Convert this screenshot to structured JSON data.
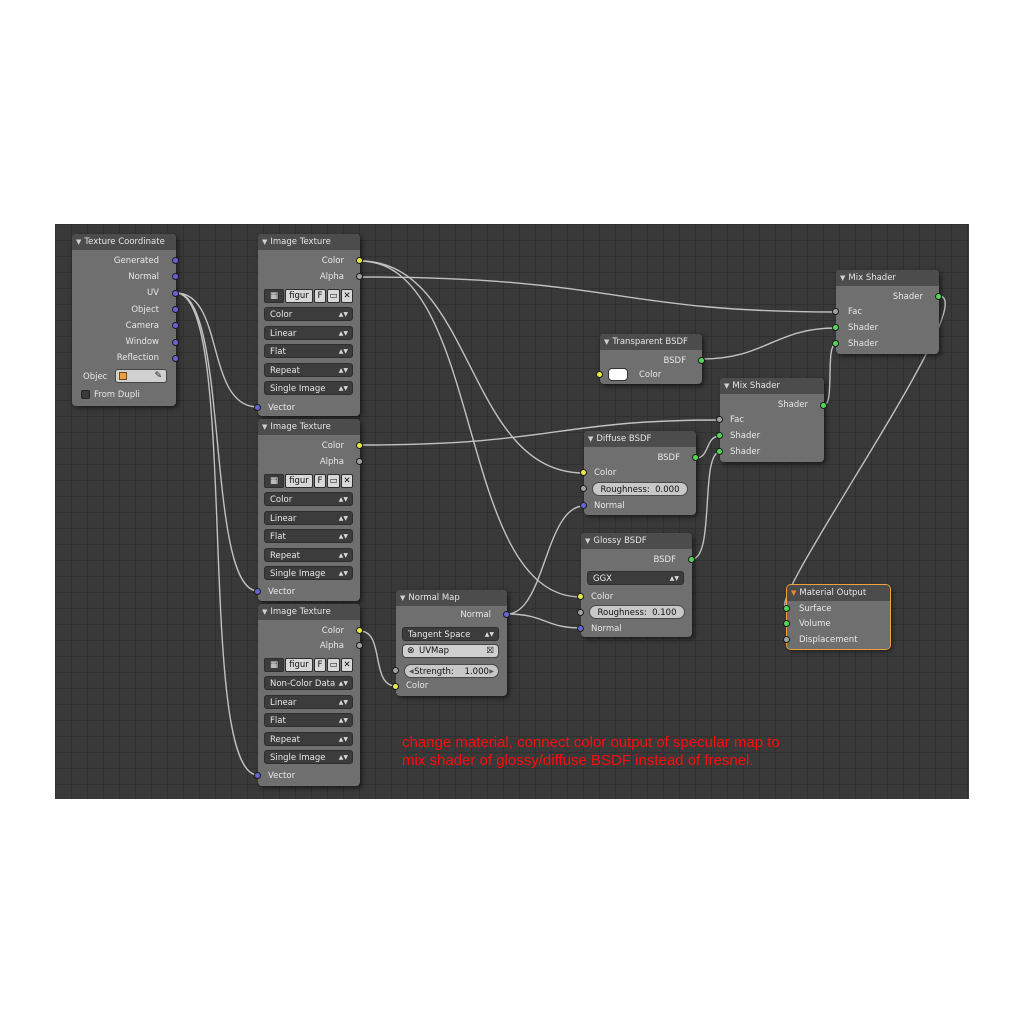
{
  "texture_coordinate": {
    "title": "Texture Coordinate",
    "outputs": [
      "Generated",
      "Normal",
      "UV",
      "Object",
      "Camera",
      "Window",
      "Reflection"
    ],
    "object_label": "Objec",
    "from_dupli_label": "From Dupli"
  },
  "image_texture_1": {
    "title": "Image Texture",
    "outputs": [
      "Color",
      "Alpha"
    ],
    "image_name": "figur",
    "fake_user": "F",
    "color_space": "Color",
    "interpolation": "Linear",
    "projection": "Flat",
    "extension": "Repeat",
    "source": "Single Image",
    "input": "Vector"
  },
  "image_texture_2": {
    "title": "Image Texture",
    "outputs": [
      "Color",
      "Alpha"
    ],
    "image_name": "figur",
    "fake_user": "F",
    "color_space": "Color",
    "interpolation": "Linear",
    "projection": "Flat",
    "extension": "Repeat",
    "source": "Single Image",
    "input": "Vector"
  },
  "image_texture_3": {
    "title": "Image Texture",
    "outputs": [
      "Color",
      "Alpha"
    ],
    "image_name": "figur",
    "fake_user": "F",
    "color_space": "Non-Color Data",
    "interpolation": "Linear",
    "projection": "Flat",
    "extension": "Repeat",
    "source": "Single Image",
    "input": "Vector"
  },
  "normal_map": {
    "title": "Normal Map",
    "output": "Normal",
    "space": "Tangent Space",
    "uv_map": "UVMap",
    "strength_label": "Strength:",
    "strength_value": "1.000",
    "input": "Color"
  },
  "transparent_bsdf": {
    "title": "Transparent BSDF",
    "output": "BSDF",
    "input": "Color",
    "color": "#ffffff"
  },
  "diffuse_bsdf": {
    "title": "Diffuse BSDF",
    "output": "BSDF",
    "inputs": [
      "Color",
      "Normal"
    ],
    "roughness_label": "Roughness:",
    "roughness_value": "0.000"
  },
  "glossy_bsdf": {
    "title": "Glossy BSDF",
    "output": "BSDF",
    "distribution": "GGX",
    "inputs": [
      "Color",
      "Normal"
    ],
    "roughness_label": "Roughness:",
    "roughness_value": "0.100"
  },
  "mix_shader_1": {
    "title": "Mix Shader",
    "output": "Shader",
    "inputs": [
      "Fac",
      "Shader",
      "Shader"
    ]
  },
  "mix_shader_2": {
    "title": "Mix Shader",
    "output": "Shader",
    "inputs": [
      "Fac",
      "Shader",
      "Shader"
    ]
  },
  "material_output": {
    "title": "Material Output",
    "inputs": [
      "Surface",
      "Volume",
      "Displacement"
    ]
  },
  "annotation": {
    "line1": "change material, connect color output of specular map to",
    "line2": "mix shader of glossy/diffuse BSDF instead of fresnel."
  },
  "colors": {
    "socket_color": "#e8e84a",
    "socket_float": "#a2a2a2",
    "socket_vector": "#6464d6",
    "socket_shader": "#54d654",
    "annotation_red": "#ff0a0a",
    "active_outline": "#f0a23c"
  }
}
